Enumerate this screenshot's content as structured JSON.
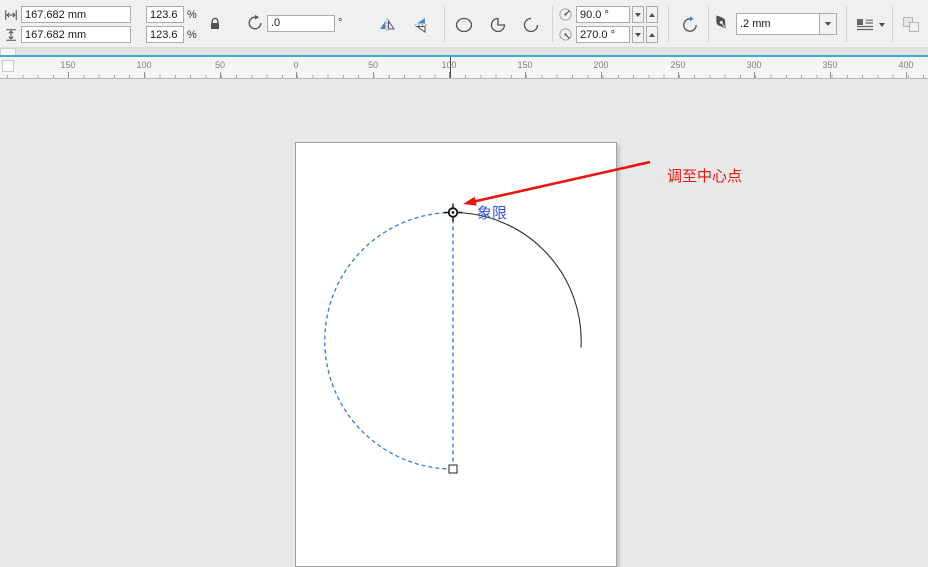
{
  "property_bar": {
    "size_width": "167.682 mm",
    "size_height": "167.682 mm",
    "scale_h": "123.6",
    "scale_v": "123.6",
    "percent": "%",
    "rotation_value": ".0",
    "degree_symbol": "°",
    "arc_start_angle": "90.0 °",
    "arc_end_angle": "270.0 °",
    "outline_width": ".2 mm"
  },
  "ruler": {
    "labels": [
      "150",
      "100",
      "50",
      "0",
      "50",
      "100",
      "150",
      "200",
      "250",
      "300",
      "350",
      "400"
    ]
  },
  "canvas": {
    "arrow_label": "调至中心点",
    "node_label": "象限"
  },
  "colors": {
    "selection-blue": "#2f7cd6",
    "annotation-red": "#e8150d",
    "label-blue": "#3353d4",
    "accent-blue-line": "#3fa7df"
  }
}
